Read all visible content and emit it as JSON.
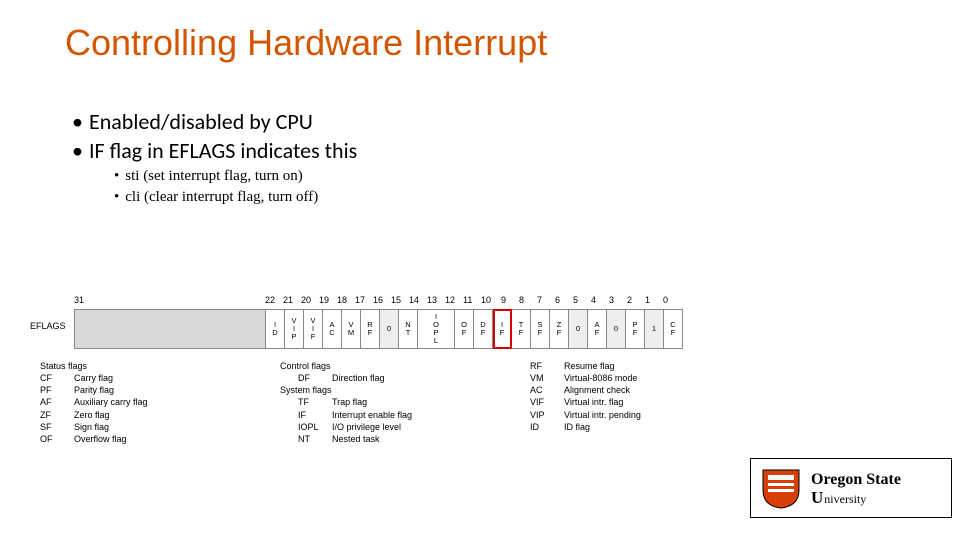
{
  "title": "Controlling Hardware Interrupt",
  "bullets": {
    "b1": "Enabled/disabled by CPU",
    "b2": "IF flag in EFLAGS indicates this",
    "s1": "sti (set interrupt flag, turn on)",
    "s2": "cli (clear interrupt flag, turn off)"
  },
  "reg": {
    "label": "EFLAGS",
    "left_num": "31",
    "nums": [
      "22",
      "21",
      "20",
      "19",
      "18",
      "17",
      "16",
      "15",
      "14",
      "13",
      "12",
      "11",
      "10",
      "9",
      "8",
      "7",
      "6",
      "5",
      "4",
      "3",
      "2",
      "1",
      "0"
    ],
    "bits": [
      "ID",
      "VIP",
      "VIF",
      "AC",
      "VM",
      "RF",
      "0",
      "NT",
      "IOPL",
      "OF",
      "DF",
      "IF",
      "TF",
      "SF",
      "ZF",
      "0",
      "AF",
      "0",
      "PF",
      "1",
      "CF"
    ]
  },
  "legend": {
    "status_hd": "Status flags",
    "status": [
      {
        "a": "CF",
        "d": "Carry flag"
      },
      {
        "a": "PF",
        "d": "Parity flag"
      },
      {
        "a": "AF",
        "d": "Auxiliary carry flag"
      },
      {
        "a": "ZF",
        "d": "Zero flag"
      },
      {
        "a": "SF",
        "d": "Sign flag"
      },
      {
        "a": "OF",
        "d": "Overflow flag"
      }
    ],
    "control_hd": "Control flags",
    "control": [
      {
        "a": "DF",
        "d": "Direction flag"
      }
    ],
    "system_hd": "System flags",
    "system": [
      {
        "a": "TF",
        "d": "Trap flag"
      },
      {
        "a": "IF",
        "d": "Interrupt enable flag"
      },
      {
        "a": "IOPL",
        "d": "I/O privilege level"
      },
      {
        "a": "NT",
        "d": "Nested task"
      }
    ],
    "right": [
      {
        "a": "RF",
        "d": "Resume flag"
      },
      {
        "a": "VM",
        "d": "Virtual-8086 mode"
      },
      {
        "a": "AC",
        "d": "Alignment check"
      },
      {
        "a": "VIF",
        "d": "Virtual intr. flag"
      },
      {
        "a": "VIP",
        "d": "Virtual intr. pending"
      },
      {
        "a": "ID",
        "d": "ID flag"
      }
    ]
  },
  "logo": {
    "l1": "Oregon State",
    "l2": "niversity",
    "u": "U"
  }
}
